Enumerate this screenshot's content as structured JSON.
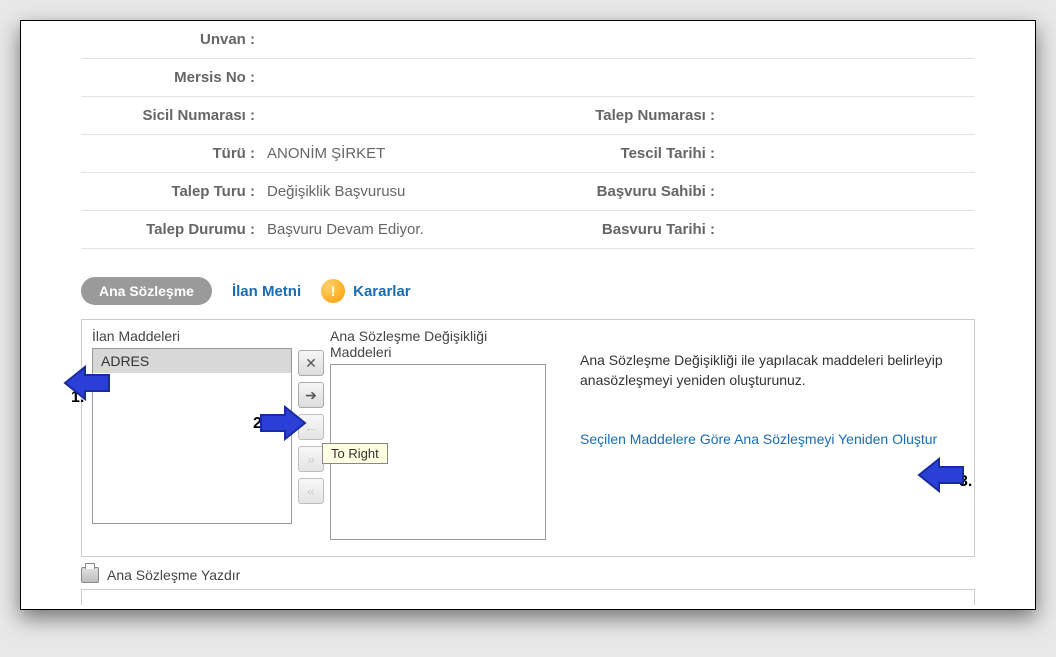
{
  "info": {
    "unvan_label": "Unvan :",
    "unvan_value": "",
    "mersis_label": "Mersis No :",
    "mersis_value": "",
    "sicil_label": "Sicil Numarası :",
    "sicil_value": "",
    "talepnum_label": "Talep Numarası :",
    "talepnum_value": "",
    "turu_label": "Türü :",
    "turu_value": "ANONİM ŞİRKET",
    "tescil_label": "Tescil Tarihi :",
    "tescil_value": "",
    "talepturu_label": "Talep Turu :",
    "talepturu_value": "Değişiklik Başvurusu",
    "basvurusahibi_label": "Başvuru Sahibi :",
    "basvurusahibi_value": "",
    "talepdurumu_label": "Talep Durumu :",
    "talepdurumu_value": "Başvuru Devam Ediyor.",
    "basvurutarihi_label": "Basvuru Tarihi :",
    "basvurutarihi_value": ""
  },
  "tabs": {
    "active": "Ana Sözleşme",
    "ilan": "İlan Metni",
    "kararlar": "Kararlar"
  },
  "lists": {
    "left_header": "İlan Maddeleri",
    "right_header": "Ana Sözleşme Değişikliği Maddeleri",
    "left_items": [
      "ADRES"
    ]
  },
  "tooltip": "To Right",
  "help": {
    "text": "Ana Sözleşme Değişikliği ile yapılacak maddeleri belirleyip anasözleşmeyi yeniden oluşturunuz.",
    "action": "Seçilen Maddelere Göre Ana Sözleşmeyi Yeniden Oluştur"
  },
  "print": "Ana Sözleşme Yazdır",
  "annotations": {
    "one": "1.",
    "two": "2.",
    "three": "3."
  }
}
